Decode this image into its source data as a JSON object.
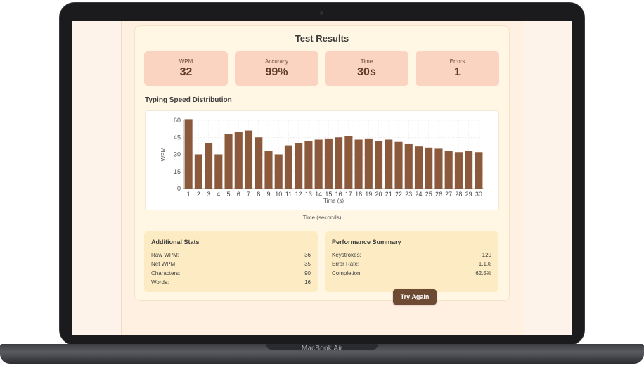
{
  "device": {
    "label": "MacBook Air"
  },
  "results": {
    "title": "Test Results",
    "stats": [
      {
        "label": "WPM",
        "value": "32"
      },
      {
        "label": "Accuracy",
        "value": "99%"
      },
      {
        "label": "Time",
        "value": "30s"
      },
      {
        "label": "Errors",
        "value": "1"
      }
    ]
  },
  "chart_section": {
    "title": "Typing Speed Distribution",
    "x_caption": "Time (seconds)"
  },
  "chart_data": {
    "type": "bar",
    "categories": [
      "1",
      "2",
      "3",
      "4",
      "5",
      "6",
      "7",
      "8",
      "9",
      "10",
      "11",
      "12",
      "13",
      "14",
      "15",
      "16",
      "17",
      "18",
      "19",
      "20",
      "21",
      "22",
      "23",
      "24",
      "25",
      "26",
      "27",
      "28",
      "29",
      "30"
    ],
    "values": [
      61,
      30,
      40,
      30,
      48,
      50,
      51,
      45,
      33,
      30,
      38,
      40,
      42,
      43,
      44,
      45,
      46,
      43,
      44,
      42,
      43,
      41,
      39,
      37,
      36,
      35,
      33,
      32,
      33,
      32
    ],
    "xlabel": "Time (s)",
    "ylabel": "WPM",
    "ylim": [
      0,
      60
    ],
    "yticks": [
      0,
      15,
      30,
      45,
      60
    ],
    "bar_color": "#8b5a3c",
    "grid": true
  },
  "additional_stats": {
    "title": "Additional Stats",
    "rows": [
      {
        "label": "Raw WPM:",
        "value": "36"
      },
      {
        "label": "Net WPM:",
        "value": "35"
      },
      {
        "label": "Characters:",
        "value": "90"
      },
      {
        "label": "Words:",
        "value": "16"
      }
    ]
  },
  "performance_summary": {
    "title": "Performance Summary",
    "rows": [
      {
        "label": "Keystrokes:",
        "value": "120"
      },
      {
        "label": "Error Rate:",
        "value": "1.1%"
      },
      {
        "label": "Completion:",
        "value": "62.5%"
      }
    ]
  },
  "actions": {
    "try_again": "Try Again"
  },
  "colors": {
    "accent": "#6e4a32",
    "stat_bg": "#fbd3c1",
    "panel_bg": "#fdecc3",
    "bar": "#8b5a3c"
  }
}
